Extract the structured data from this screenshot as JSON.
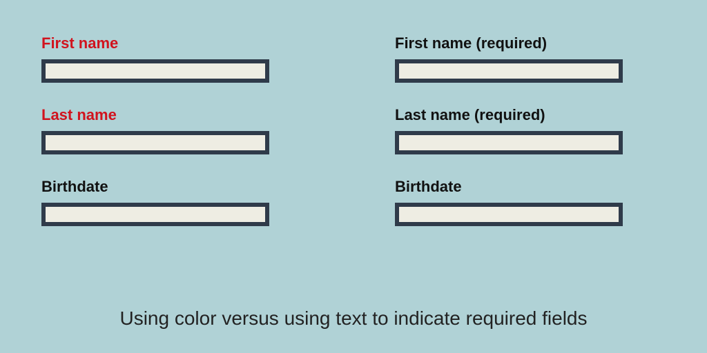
{
  "left": {
    "fields": [
      {
        "label": "First name",
        "required_style": "color"
      },
      {
        "label": "Last name",
        "required_style": "color"
      },
      {
        "label": "Birthdate",
        "required_style": "none"
      }
    ]
  },
  "right": {
    "fields": [
      {
        "label": "First name (required)",
        "required_style": "text"
      },
      {
        "label": "Last name (required)",
        "required_style": "text"
      },
      {
        "label": "Birthdate",
        "required_style": "none"
      }
    ]
  },
  "caption": "Using color versus using text to indicate required fields",
  "colors": {
    "background": "#b0d2d6",
    "required_label": "#d1131e",
    "input_border": "#2f3b4a",
    "input_fill": "#eeede3"
  }
}
